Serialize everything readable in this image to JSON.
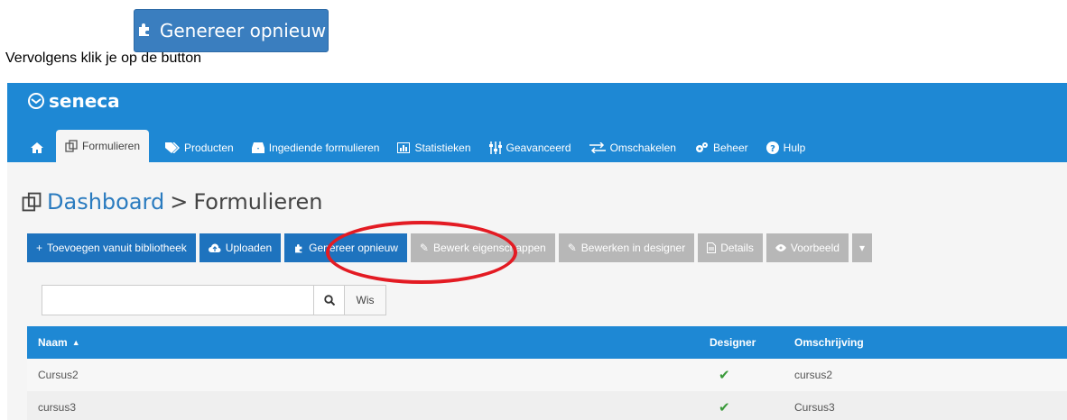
{
  "instruction": {
    "text": "Vervolgens klik je op de button",
    "button_label": "Genereer opnieuw",
    "button_icon": "puzzle-icon"
  },
  "app": {
    "logo": "seneca",
    "nav": [
      {
        "label": "",
        "icon": "home-icon"
      },
      {
        "label": "Formulieren",
        "icon": "forms-icon",
        "active": true
      },
      {
        "label": "Producten",
        "icon": "tags-icon"
      },
      {
        "label": "Ingediende formulieren",
        "icon": "inbox-icon"
      },
      {
        "label": "Statistieken",
        "icon": "chart-icon"
      },
      {
        "label": "Geavanceerd",
        "icon": "sliders-icon"
      },
      {
        "label": "Omschakelen",
        "icon": "exchange-icon"
      },
      {
        "label": "Beheer",
        "icon": "cogs-icon"
      },
      {
        "label": "Hulp",
        "icon": "help-icon"
      }
    ],
    "breadcrumb": {
      "dashboard": "Dashboard",
      "separator": ">",
      "current": "Formulieren"
    },
    "toolbar": {
      "add": "Toevoegen vanuit bibliotheek",
      "upload": "Uploaden",
      "regenerate": "Genereer opnieuw",
      "edit_props": "Bewerk eigenschappen",
      "edit_designer": "Bewerken in designer",
      "details": "Details",
      "preview": "Voorbeeld"
    },
    "search": {
      "value": "",
      "placeholder": "",
      "clear": "Wis"
    },
    "table": {
      "columns": {
        "name": "Naam",
        "designer": "Designer",
        "description": "Omschrijving"
      },
      "rows": [
        {
          "name": "Cursus2",
          "designer": true,
          "description": "cursus2"
        },
        {
          "name": "cursus3",
          "designer": true,
          "description": "Cursus3"
        }
      ]
    },
    "colors": {
      "topbar": "#1e88d4",
      "primary_button": "#1e73be",
      "disabled_button": "#b7b7b7",
      "highlight": "#e31b23"
    }
  }
}
